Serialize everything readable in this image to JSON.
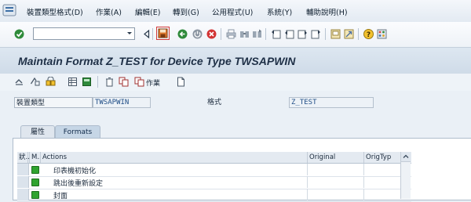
{
  "menu": {
    "items": [
      "裝置類型格式(D)",
      "作業(A)",
      "編輯(E)",
      "轉到(G)",
      "公用程式(U)",
      "系統(Y)",
      "輔助說明(H)"
    ]
  },
  "toolbar": {
    "command_field_value": "",
    "icons": [
      "enter-icon",
      "command-dropdown-icon",
      "back-arrow-icon",
      "save-icon",
      "back-icon",
      "exit-icon",
      "cancel-icon",
      "print-icon",
      "find-icon",
      "find-next-icon",
      "first-page-icon",
      "previous-page-icon",
      "next-page-icon",
      "last-page-icon",
      "new-session-icon",
      "shortcut-icon",
      "help-icon",
      "layout-icon"
    ]
  },
  "title": "Maintain Format Z_TEST for Device Type TWSAPWIN",
  "app_toolbar": {
    "work_label": "作業",
    "icons": [
      "other-object-icon",
      "display-change-icon",
      "activate-icon",
      "select-all-icon",
      "insert-icon",
      "delete-icon",
      "copy-icon",
      "work-icon",
      "new-icon"
    ]
  },
  "header": {
    "device_type_label": "裝置類型",
    "device_type_value": "TWSAPWIN",
    "format_label": "格式",
    "format_value": "Z_TEST"
  },
  "tabs": [
    {
      "label": "屬性",
      "active": false
    },
    {
      "label": "Formats",
      "active": true
    }
  ],
  "table": {
    "columns": [
      "狀...",
      "M...",
      "Actions",
      "Original",
      "OrigTyp"
    ],
    "rows": [
      {
        "status": "green",
        "action": "印表機初始化"
      },
      {
        "status": "green",
        "action": "跳出後重新設定"
      },
      {
        "status": "green",
        "action": "封面"
      }
    ]
  },
  "colors": {
    "status_green": "#2fa32f",
    "title_bg": "#d6e1ec",
    "value_text": "#1f4d86"
  }
}
